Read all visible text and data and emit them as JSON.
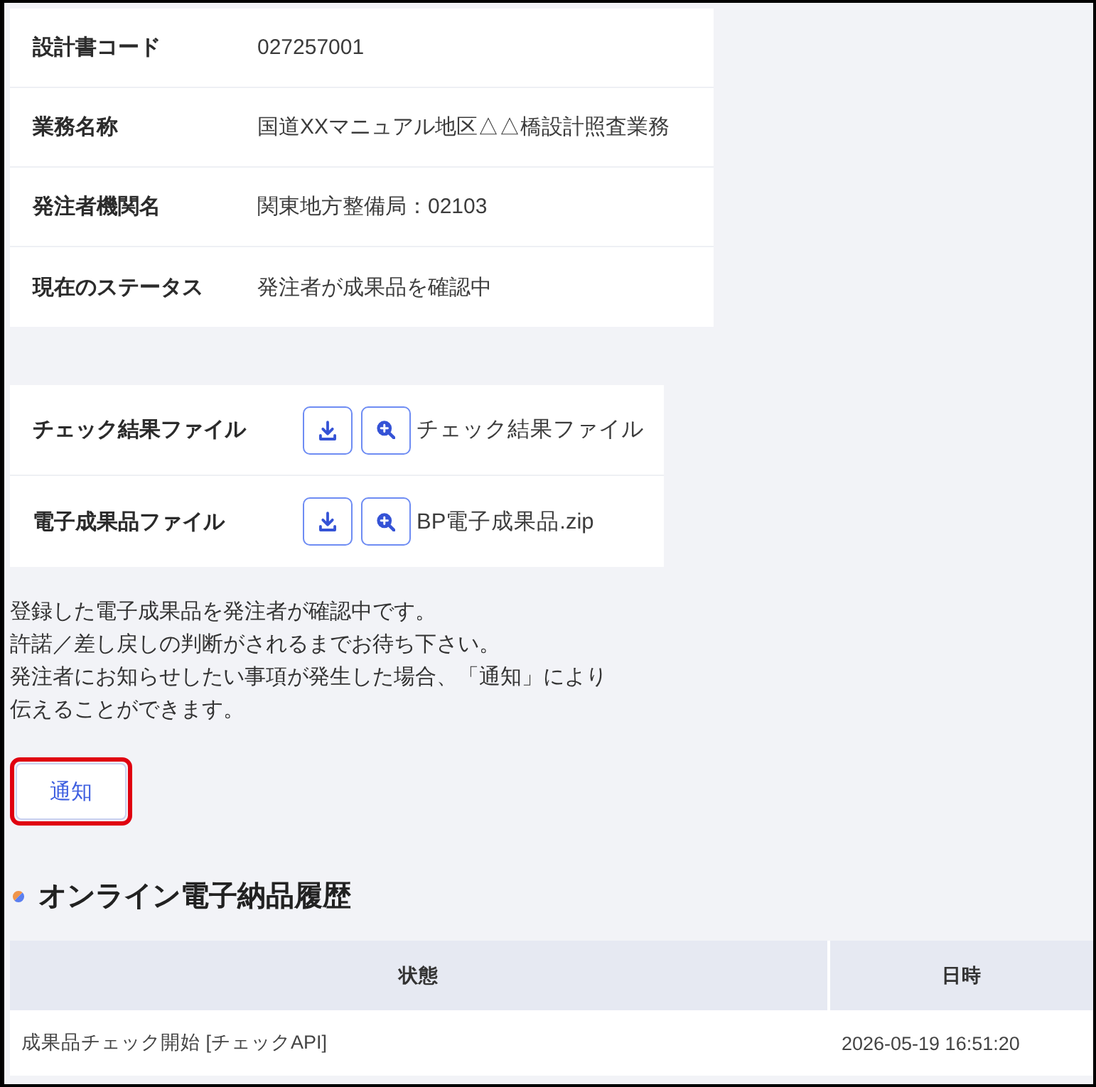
{
  "info_table": {
    "rows": [
      {
        "label": "設計書コード",
        "value": "027257001"
      },
      {
        "label": "業務名称",
        "value": "国道XXマニュアル地区△△橋設計照査業務"
      },
      {
        "label": "発注者機関名",
        "value": "関東地方整備局：02103"
      },
      {
        "label": "現在のステータス",
        "value": "発注者が成果品を確認中"
      }
    ]
  },
  "files": {
    "rows": [
      {
        "label": "チェック結果ファイル",
        "file_name": "チェック結果ファイル"
      },
      {
        "label": "電子成果品ファイル",
        "file_name": "BP電子成果品.zip"
      }
    ]
  },
  "message": {
    "lines": [
      "登録した電子成果品を発注者が確認中です。",
      "許諾／差し戻しの判断がされるまでお待ち下さい。",
      "発注者にお知らせしたい事項が発生した場合、「通知」により",
      "伝えることができます。"
    ]
  },
  "notify_button": {
    "label": "通知",
    "highlighted": true
  },
  "history": {
    "title": "オンライン電子納品履歴",
    "columns": [
      "状態",
      "日時"
    ],
    "rows": [
      {
        "status": "成果品チェック開始 [チェックAPI]",
        "datetime": "2026-05-19 16:51:20"
      }
    ]
  }
}
